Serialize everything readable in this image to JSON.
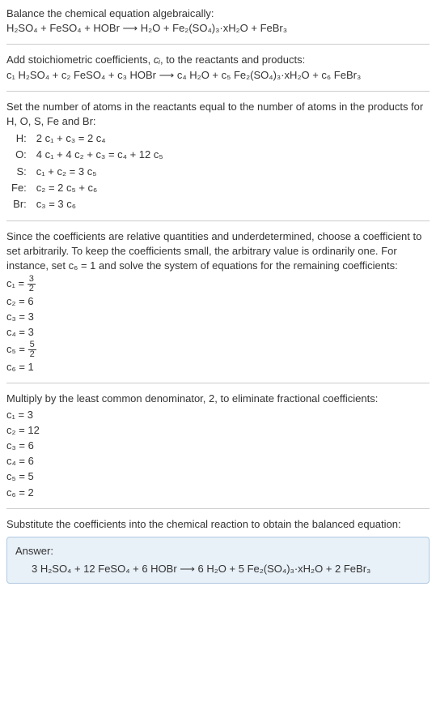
{
  "intro": {
    "line1": "Balance the chemical equation algebraically:",
    "eq1": "H₂SO₄ + FeSO₄ + HOBr ⟶ H₂O + Fe₂(SO₄)₃·xH₂O + FeBr₃"
  },
  "stoich": {
    "line1_a": "Add stoichiometric coefficients, ",
    "line1_b": ", to the reactants and products:",
    "ci": "cᵢ",
    "eq": "c₁ H₂SO₄ + c₂ FeSO₄ + c₃ HOBr ⟶ c₄ H₂O + c₅ Fe₂(SO₄)₃·xH₂O + c₆ FeBr₃"
  },
  "atoms": {
    "intro": "Set the number of atoms in the reactants equal to the number of atoms in the products for H, O, S, Fe and Br:",
    "rows": [
      {
        "el": "H:",
        "eq": "2 c₁ + c₃ = 2 c₄"
      },
      {
        "el": "O:",
        "eq": "4 c₁ + 4 c₂ + c₃ = c₄ + 12 c₅"
      },
      {
        "el": "S:",
        "eq": "c₁ + c₂ = 3 c₅"
      },
      {
        "el": "Fe:",
        "eq": "c₂ = 2 c₅ + c₆"
      },
      {
        "el": "Br:",
        "eq": "c₃ = 3 c₆"
      }
    ]
  },
  "underdet": {
    "text": "Since the coefficients are relative quantities and underdetermined, choose a coefficient to set arbitrarily. To keep the coefficients small, the arbitrary value is ordinarily one. For instance, set c₆ = 1 and solve the system of equations for the remaining coefficients:",
    "c1_label": "c₁ = ",
    "c1_num": "3",
    "c1_den": "2",
    "c2": "c₂ = 6",
    "c3": "c₃ = 3",
    "c4": "c₄ = 3",
    "c5_label": "c₅ = ",
    "c5_num": "5",
    "c5_den": "2",
    "c6": "c₆ = 1"
  },
  "multiply": {
    "text": "Multiply by the least common denominator, 2, to eliminate fractional coefficients:",
    "c1": "c₁ = 3",
    "c2": "c₂ = 12",
    "c3": "c₃ = 6",
    "c4": "c₄ = 6",
    "c5": "c₅ = 5",
    "c6": "c₆ = 2"
  },
  "substitute": {
    "text": "Substitute the coefficients into the chemical reaction to obtain the balanced equation:"
  },
  "answer": {
    "label": "Answer:",
    "eq": "3 H₂SO₄ + 12 FeSO₄ + 6 HOBr ⟶ 6 H₂O + 5 Fe₂(SO₄)₃·xH₂O + 2 FeBr₃"
  }
}
